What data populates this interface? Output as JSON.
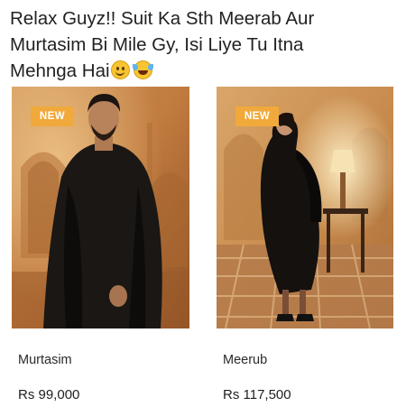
{
  "caption": {
    "line1": "Relax Guyz!! Suit Ka Sth Meerab Aur",
    "line2": "Murtasim Bi Mile Gy, Isi Liye Tu Itna",
    "line3": "Mehnga Hai",
    "emojis": [
      "slightly-smiling-face-icon",
      "face-with-tears-of-joy-icon"
    ]
  },
  "products": [
    {
      "badge": "NEW",
      "name": "Murtasim",
      "price": "Rs 99,000"
    },
    {
      "badge": "NEW",
      "name": "Meerub",
      "price": "Rs 117,500"
    }
  ],
  "colors": {
    "badge": "#f0a93a",
    "background_warm": "#c98a4e",
    "garment": "#141210"
  }
}
